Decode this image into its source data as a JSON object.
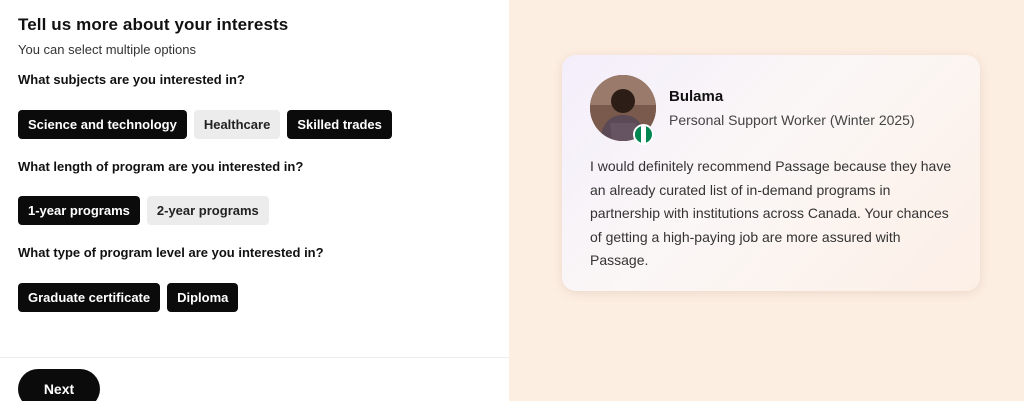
{
  "form": {
    "title": "Tell us more about your interests",
    "subtitle": "You can select multiple options",
    "questions": [
      {
        "label": "What subjects are you interested in?",
        "options": [
          {
            "label": "Science and technology",
            "selected": true
          },
          {
            "label": "Healthcare",
            "selected": false
          },
          {
            "label": "Skilled trades",
            "selected": true
          }
        ]
      },
      {
        "label": "What length of program are you interested in?",
        "options": [
          {
            "label": "1-year programs",
            "selected": true
          },
          {
            "label": "2-year programs",
            "selected": false
          }
        ]
      },
      {
        "label": "What type of program level are you interested in?",
        "options": [
          {
            "label": "Graduate certificate",
            "selected": true
          },
          {
            "label": "Diploma",
            "selected": true
          }
        ]
      }
    ],
    "next_label": "Next"
  },
  "testimonial": {
    "name": "Bulama",
    "role": "Personal Support Worker (Winter 2025)",
    "quote": "I would definitely recommend Passage because they have an already curated list of in-demand programs in partnership with institutions across Canada. Your chances of getting a high-paying job are more assured with Passage.",
    "avatar_icon": "person-photo",
    "flag_icon": "nigeria-flag-icon",
    "flag_colors": [
      "#008751",
      "#ffffff",
      "#008751"
    ]
  },
  "colors": {
    "accent": "#0b0b0b",
    "unselected_chip": "#ececec",
    "right_panel_bg": "#fdeee2"
  }
}
